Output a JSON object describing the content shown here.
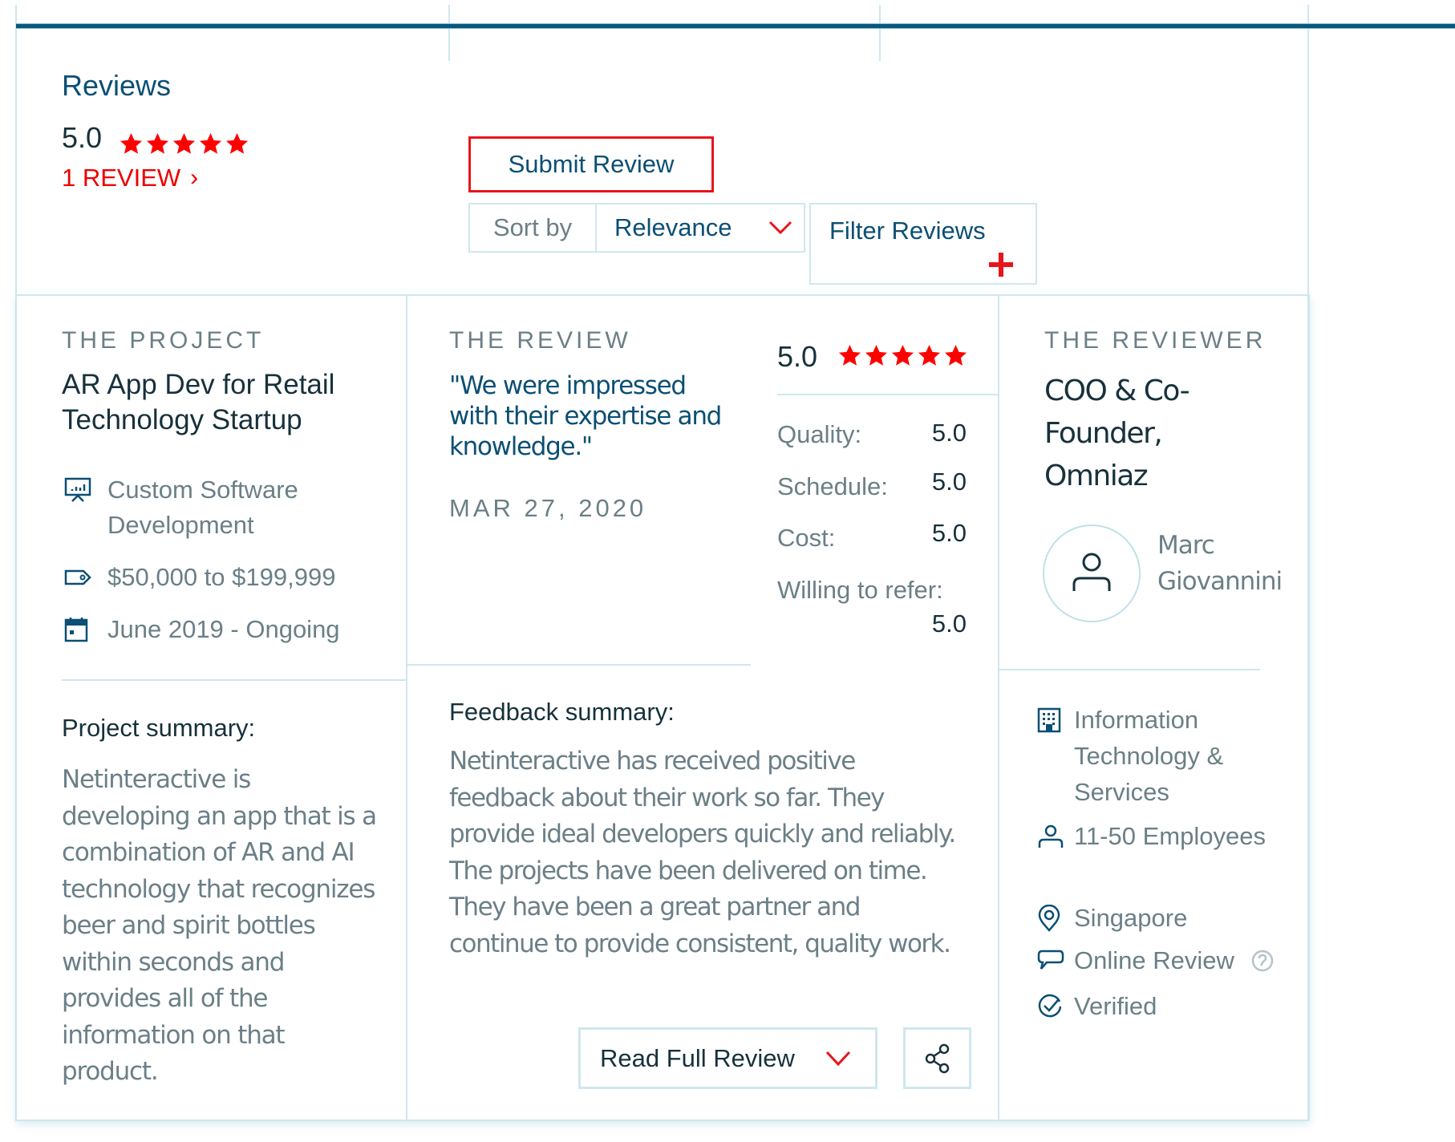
{
  "header": {
    "title": "Reviews",
    "overall_rating": "5.0",
    "overall_stars": 5,
    "review_count_label": "1 REVIEW",
    "review_count_chevron": "›",
    "submit_review_label": "Submit Review",
    "sort_by_label": "Sort by",
    "sort_selected": "Relevance",
    "filter_label": "Filter Reviews"
  },
  "colors": {
    "accent_red": "#e8141b",
    "brand_blue": "#0b4f74",
    "top_bar": "#07577f",
    "border": "#cfe7ee",
    "muted_text": "#6b7f87"
  },
  "review": {
    "project": {
      "section_label": "THE PROJECT",
      "title": "AR App Dev for Retail Technology Startup",
      "service": "Custom Software Development",
      "budget": "$50,000 to $199,999",
      "dates": "June 2019 - Ongoing",
      "summary_heading": "Project summary:",
      "summary": "Netinteractive is developing an app that is a combination of AR and AI technology that recognizes beer and spirit bottles within seconds and provides all of the information on that product."
    },
    "the_review": {
      "section_label": "THE REVIEW",
      "quote": "\"We were impressed with their expertise and knowledge.\"",
      "date": "MAR 27, 2020",
      "overall": "5.0",
      "stars": 5,
      "ratings": [
        {
          "label": "Quality:",
          "value": "5.0"
        },
        {
          "label": "Schedule:",
          "value": "5.0"
        },
        {
          "label": "Cost:",
          "value": "5.0"
        },
        {
          "label": "Willing to refer:",
          "value": "5.0"
        }
      ],
      "feedback_heading": "Feedback summary:",
      "feedback": "Netinteractive has received positive feedback about their work so far. They provide ideal developers quickly and reliably. The projects have been delivered on time. They have been a great partner and continue to provide consistent, quality work.",
      "read_full_label": "Read Full Review"
    },
    "reviewer": {
      "section_label": "THE REVIEWER",
      "title": "COO & Co-Founder, Omniaz",
      "name": "Marc Giovannini",
      "industry": "Information Technology & Services",
      "company_size": "11-50 Employees",
      "location": "Singapore",
      "source": "Online Review",
      "verification": "Verified"
    }
  },
  "icons": {
    "stars": "star-icon",
    "service": "presentation-chart-icon",
    "budget": "price-tag-icon",
    "dates": "calendar-icon",
    "avatar": "user-icon",
    "industry": "building-icon",
    "size": "person-icon",
    "location": "map-pin-icon",
    "source": "speech-bubble-icon",
    "help": "question-circle-icon",
    "verified": "check-circle-icon",
    "share": "share-icon",
    "dropdown": "chevron-down-icon",
    "filter_add": "plus-icon"
  }
}
